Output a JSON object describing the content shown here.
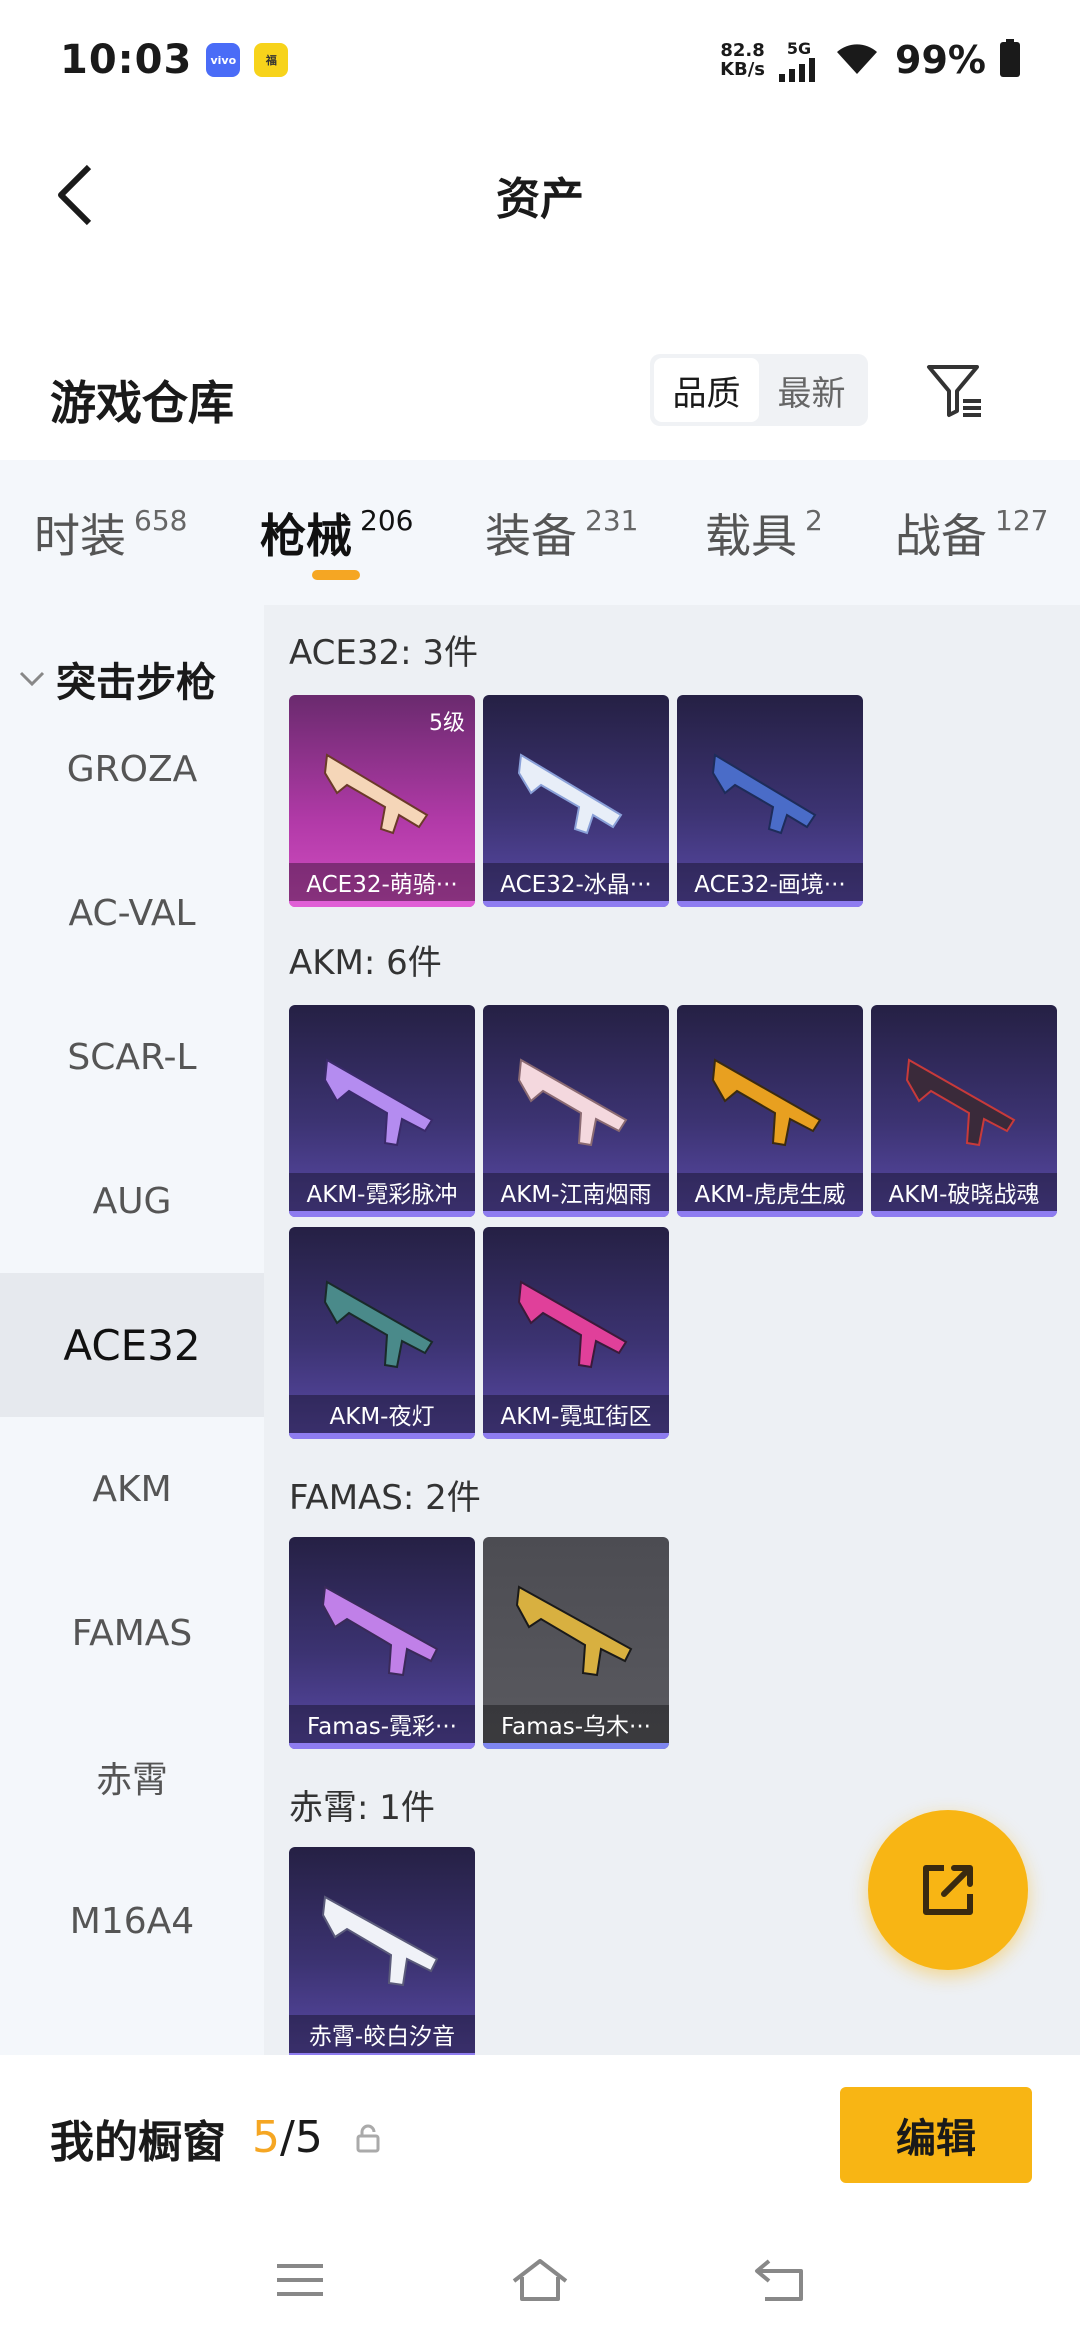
{
  "status_bar": {
    "time": "10:03",
    "badge1": "vivo",
    "badge2": "福",
    "net_speed_value": "82.8",
    "net_speed_unit": "KB/s",
    "net_type": "5G",
    "battery": "99%"
  },
  "header": {
    "title": "资产"
  },
  "warehouse": {
    "title": "游戏仓库",
    "sort_options": [
      "品质",
      "最新"
    ],
    "sort_selected": "品质"
  },
  "tabs": [
    {
      "label": "时装",
      "count": "658"
    },
    {
      "label": "枪械",
      "count": "206"
    },
    {
      "label": "装备",
      "count": "231"
    },
    {
      "label": "载具",
      "count": "2"
    },
    {
      "label": "战备",
      "count": "127"
    }
  ],
  "active_tab": "枪械",
  "sidebar": {
    "group_label": "突击步枪",
    "items": [
      "GROZA",
      "AC-VAL",
      "SCAR-L",
      "AUG",
      "ACE32",
      "AKM",
      "FAMAS",
      "赤霄",
      "M16A4"
    ],
    "active_item": "ACE32"
  },
  "sections": [
    {
      "title": "ACE32: 3件",
      "items": [
        {
          "label": "ACE32-萌骑···",
          "level": "5级"
        },
        {
          "label": "ACE32-冰晶···"
        },
        {
          "label": "ACE32-画境···"
        }
      ]
    },
    {
      "title": "AKM: 6件",
      "items": [
        {
          "label": "AKM-霓彩脉冲"
        },
        {
          "label": "AKM-江南烟雨"
        },
        {
          "label": "AKM-虎虎生威"
        },
        {
          "label": "AKM-破晓战魂"
        },
        {
          "label": "AKM-夜灯"
        },
        {
          "label": "AKM-霓虹街区"
        }
      ]
    },
    {
      "title": "FAMAS: 2件",
      "items": [
        {
          "label": "Famas-霓彩···"
        },
        {
          "label": "Famas-乌木···"
        }
      ]
    },
    {
      "title": "赤霄: 1件",
      "items": [
        {
          "label": "赤霄-皎白汐音"
        }
      ]
    }
  ],
  "showcase": {
    "label": "我的橱窗",
    "count_current": "5",
    "count_sep": "/",
    "count_total": "5",
    "edit_label": "编辑"
  },
  "colors": {
    "accent": "#f8b514",
    "tab_underline": "#f5a623",
    "card_purple": "#3c3372",
    "card_pink": "#b23aa8",
    "card_gray": "#55555b"
  }
}
